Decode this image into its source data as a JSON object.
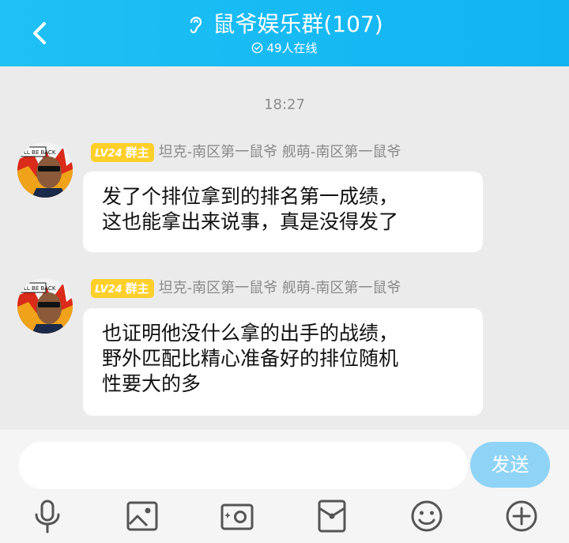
{
  "header": {
    "title": "鼠爷娱乐群(107)",
    "online": "49人在线"
  },
  "chat": {
    "timestamp": "18:27",
    "messages": [
      {
        "level": "LV24",
        "role": "群主",
        "sender": "坦克-南区第一鼠爷 舰萌-南区第一鼠爷",
        "avatar_caption": "I'LL BE BACK",
        "lines": [
          "发了个排位拿到的排名第一成绩，",
          "这也能拿出来说事，真是没得发了"
        ]
      },
      {
        "level": "LV24",
        "role": "群主",
        "sender": "坦克-南区第一鼠爷 舰萌-南区第一鼠爷",
        "avatar_caption": "I'LL BE BACK",
        "lines": [
          "也证明他没什么拿的出手的战绩，",
          "野外匹配比精心准备好的排位随机",
          "性要大的多"
        ]
      }
    ]
  },
  "composer": {
    "input_value": "",
    "send_label": "发送"
  },
  "toolbar": [
    "microphone-icon",
    "image-icon",
    "camera-icon",
    "red-packet-icon",
    "emoji-icon",
    "plus-icon"
  ],
  "colors": {
    "header": "#16b8f3",
    "badge": "#ffcf2a",
    "send_button": "#8fd3f7",
    "background": "#ebebeb"
  }
}
